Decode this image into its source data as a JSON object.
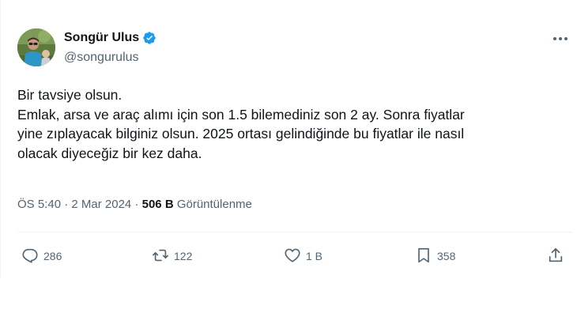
{
  "author": {
    "name": "Songür Ulus",
    "handle": "@songurulus",
    "verified": true
  },
  "tweet": {
    "lines": [
      "Bir tavsiye olsun.",
      "Emlak, arsa ve araç alımı için son 1.5 bilemediniz son 2 ay. Sonra fiyatlar",
      "yine zıplayacak bilginiz olsun. 2025 ortası gelindiğinde bu fiyatlar ile nasıl",
      "olacak diyeceğiz bir kez daha."
    ]
  },
  "meta": {
    "time": "ÖS 5:40",
    "sep1": "·",
    "date": "2 Mar 2024",
    "sep2": "·",
    "views_count": "506 B",
    "views_label": "Görüntülenme"
  },
  "actions": {
    "replies": "286",
    "reposts": "122",
    "likes": "1 B",
    "bookmarks": "358"
  },
  "colors": {
    "verified_badge": "#1d9bf0",
    "secondary_text": "#536471",
    "primary_text": "#0f1419"
  },
  "icons": [
    "verified-badge-icon",
    "more-icon",
    "reply-icon",
    "repost-icon",
    "like-icon",
    "bookmark-icon",
    "share-icon"
  ]
}
